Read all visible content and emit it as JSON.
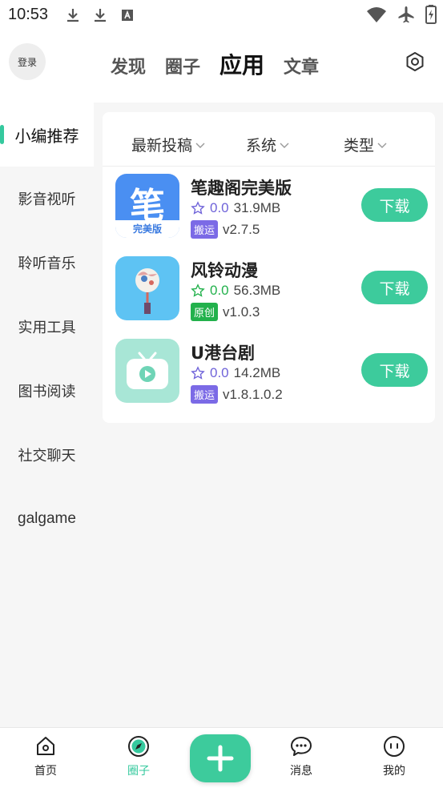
{
  "status_bar": {
    "time": "10:53"
  },
  "header": {
    "login_label": "登录",
    "tabs": [
      {
        "label": "发现"
      },
      {
        "label": "圈子"
      },
      {
        "label": "应用",
        "active": true
      },
      {
        "label": "文章"
      }
    ]
  },
  "sidebar": {
    "items": [
      {
        "label": "小编推荐",
        "active": true
      },
      {
        "label": "影音视听"
      },
      {
        "label": "聆听音乐"
      },
      {
        "label": "实用工具"
      },
      {
        "label": "图书阅读"
      },
      {
        "label": "社交聊天"
      },
      {
        "label": "galgame"
      }
    ]
  },
  "filters": [
    {
      "label": "最新投稿"
    },
    {
      "label": "系统"
    },
    {
      "label": "类型"
    }
  ],
  "apps": [
    {
      "name": "笔趣阁完美版",
      "rating": "0.0",
      "size": "31.9MB",
      "badge": "搬运",
      "version": "v2.7.5",
      "icon_text": "笔",
      "icon_sub": "完美版",
      "button": "下载"
    },
    {
      "name": "风铃动漫",
      "rating": "0.0",
      "size": "56.3MB",
      "badge": "原创",
      "version": "v1.0.3",
      "button": "下载"
    },
    {
      "name": "U港台剧",
      "rating": "0.0",
      "size": "14.2MB",
      "badge": "搬运",
      "version": "v1.8.1.0.2",
      "button": "下载"
    }
  ],
  "bottom_nav": [
    {
      "label": "首页"
    },
    {
      "label": "圈子",
      "active": true
    },
    {
      "label": "消息"
    },
    {
      "label": "我的"
    }
  ],
  "colors": {
    "accent": "#3dcb9c",
    "rating": "#6f63d9",
    "badge_move": "#7b6ae6",
    "badge_orig": "#22b14c"
  }
}
